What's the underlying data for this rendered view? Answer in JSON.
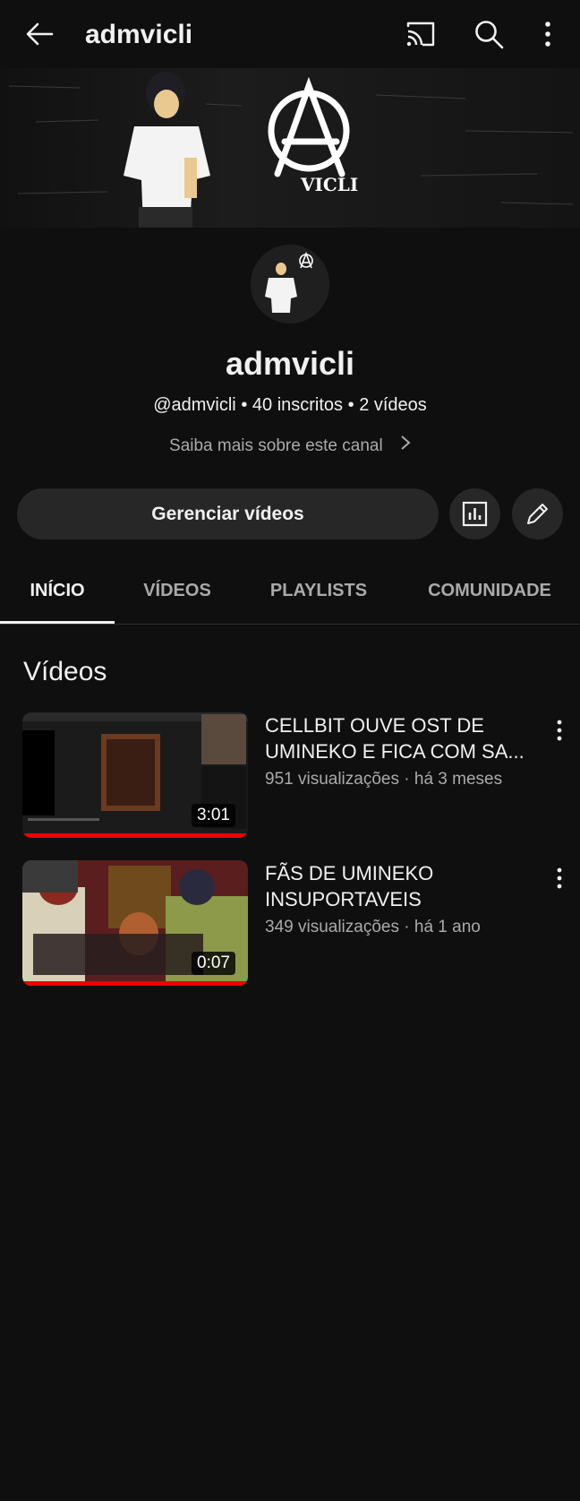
{
  "header": {
    "title": "admvicli",
    "back_icon": "arrow-left-icon",
    "cast_icon": "cast-icon",
    "search_icon": "search-icon",
    "more_icon": "more-vertical-icon"
  },
  "banner": {
    "logo_text": "VICLI"
  },
  "channel": {
    "name": "admvicli",
    "handle": "@admvicli",
    "subscribers": "40 inscritos",
    "video_count": "2 vídeos",
    "separator": "•",
    "about_label": "Saiba mais sobre este canal"
  },
  "actions": {
    "manage_label": "Gerenciar vídeos",
    "stats_icon": "analytics-icon",
    "edit_icon": "pencil-icon"
  },
  "tabs": [
    {
      "label": "INÍCIO",
      "active": true
    },
    {
      "label": "VÍDEOS",
      "active": false
    },
    {
      "label": "PLAYLISTS",
      "active": false
    },
    {
      "label": "COMUNIDADE",
      "active": false
    }
  ],
  "section": {
    "title": "Vídeos"
  },
  "videos": [
    {
      "title": "CELLBIT OUVE OST DE UMINEKO E FICA COM SA...",
      "views": "951 visualizações",
      "age": "há 3 meses",
      "duration": "3:01",
      "separator": "·"
    },
    {
      "title": "FÃS DE UMINEKO INSUPORTAVEIS",
      "views": "349 visualizações",
      "age": "há 1 ano",
      "duration": "0:07",
      "separator": "·"
    }
  ],
  "colors": {
    "background": "#0f0f0f",
    "surface": "#272727",
    "text": "#f1f1f1",
    "secondary": "#aaaaaa",
    "progress": "#ee0000"
  }
}
